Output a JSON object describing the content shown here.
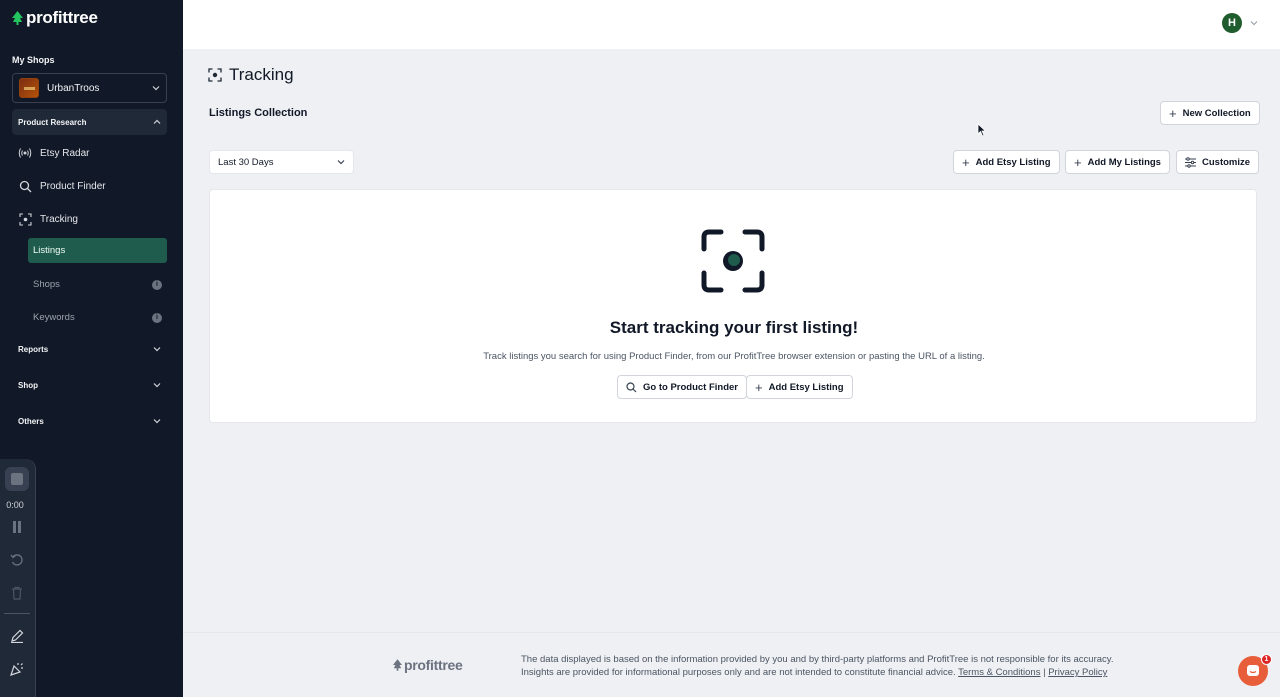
{
  "app": {
    "brand": "profittree"
  },
  "sidebar": {
    "my_shops_label": "My Shops",
    "shop": {
      "name": "UrbanTroos"
    },
    "product_research": {
      "label": "Product Research",
      "items": [
        {
          "label": "Etsy Radar",
          "icon": "radar-icon"
        },
        {
          "label": "Product Finder",
          "icon": "search-icon"
        },
        {
          "label": "Tracking",
          "icon": "tracking-icon"
        }
      ],
      "tracking_sub": [
        {
          "label": "Listings",
          "active": true
        },
        {
          "label": "Shops",
          "info": "i"
        },
        {
          "label": "Keywords",
          "info": "i"
        }
      ]
    },
    "groups": [
      {
        "label": "Reports"
      },
      {
        "label": "Shop"
      },
      {
        "label": "Others"
      }
    ]
  },
  "recorder": {
    "time": "0:00"
  },
  "header": {
    "avatar_initial": "H"
  },
  "main": {
    "title": "Tracking",
    "subtitle": "Listings Collection",
    "new_collection_label": "New Collection",
    "date_range": "Last 30 Days",
    "toolbar": {
      "add_etsy_listing": "Add Etsy Listing",
      "add_my_listings": "Add My Listings",
      "customize": "Customize"
    },
    "empty": {
      "title": "Start tracking your first listing!",
      "description": "Track listings you search for using Product Finder, from our ProfitTree browser extension or pasting the URL of a listing.",
      "go_to_finder": "Go to Product Finder",
      "add_etsy_listing": "Add Etsy Listing"
    }
  },
  "footer": {
    "brand": "profittree",
    "line1": "The data displayed is based on the information provided by you and by third-party platforms and ProfitTree is not responsible for its accuracy.",
    "line2": "Insights are provided for informational purposes only and are not intended to constitute financial advice.",
    "terms": "Terms & Conditions",
    "separator": "|",
    "privacy": "Privacy Policy"
  },
  "chat": {
    "badge": "1"
  },
  "colors": {
    "sidebar_bg": "#111827",
    "accent": "#1f5c4e",
    "brand_green": "#22c55e"
  }
}
